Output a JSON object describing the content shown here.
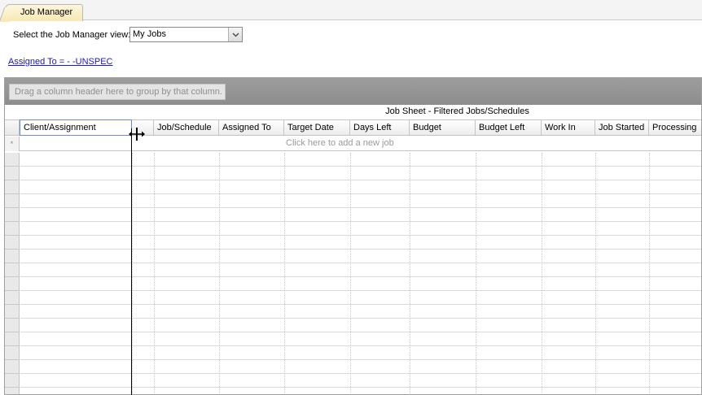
{
  "tab": {
    "label": "Job Manager"
  },
  "view_selector": {
    "label": "Select the Job Manager view:",
    "value": "My Jobs",
    "arrow": "chevron-down-icon"
  },
  "filter_link": "Assigned To = - -UNSPEC",
  "grid": {
    "group_hint": "Drag a column header here to group by that column.",
    "sheet_title": "Job Sheet - Filtered Jobs/Schedules",
    "columns": [
      "Client/Assignment",
      "Job/Schedule",
      "Assigned To",
      "Target Date",
      "Days Left",
      "Budget",
      "Budget Left",
      "Work In",
      "Job Started",
      "Processing"
    ],
    "new_row_marker": "*",
    "new_row_hint": "Click here to add a new job",
    "rows": []
  },
  "colors": {
    "header_selected_border": "#6a8ccc",
    "group_panel": "#959595",
    "link": "#1a1ab8"
  }
}
